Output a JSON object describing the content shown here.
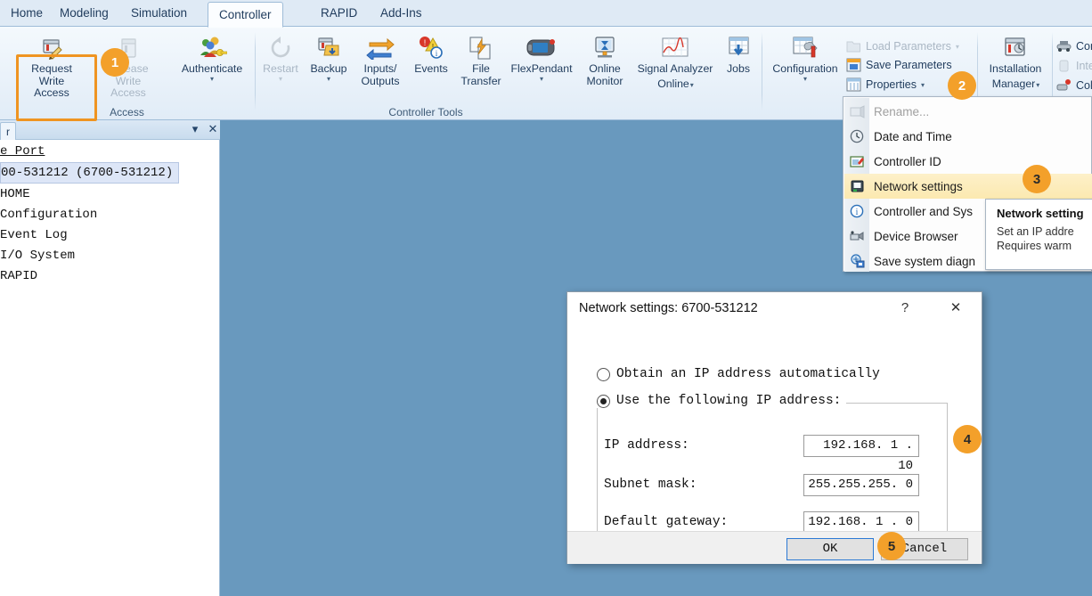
{
  "ribbon": {
    "tabs": [
      {
        "label": "Home",
        "active": false
      },
      {
        "label": "Modeling",
        "active": false
      },
      {
        "label": "Simulation",
        "active": false
      },
      {
        "label": "Controller",
        "active": true
      },
      {
        "label": "RAPID",
        "active": false
      },
      {
        "label": "Add-Ins",
        "active": false
      }
    ],
    "groups": {
      "access": {
        "label": "Access",
        "items": [
          {
            "name": "request-write-access",
            "label_line1": "Request",
            "label_line2": "Write Access",
            "disabled": false,
            "caret": false
          },
          {
            "name": "release-write-access",
            "label_line1": "Release",
            "label_line2": "Write Access",
            "disabled": true,
            "caret": false
          },
          {
            "name": "authenticate",
            "label_line1": "Authenticate",
            "label_line2": "",
            "disabled": false,
            "caret": true
          }
        ]
      },
      "controller_tools": {
        "label": "Controller Tools",
        "items": [
          {
            "name": "restart",
            "label_line1": "Restart",
            "label_line2": "",
            "disabled": true,
            "caret": true
          },
          {
            "name": "backup",
            "label_line1": "Backup",
            "label_line2": "",
            "disabled": false,
            "caret": true
          },
          {
            "name": "inputs-outputs",
            "label_line1": "Inputs/",
            "label_line2": "Outputs",
            "disabled": false,
            "caret": false
          },
          {
            "name": "events",
            "label_line1": "Events",
            "label_line2": "",
            "disabled": false,
            "caret": false
          },
          {
            "name": "file-transfer",
            "label_line1": "File",
            "label_line2": "Transfer",
            "disabled": false,
            "caret": false
          },
          {
            "name": "flexpendant",
            "label_line1": "FlexPendant",
            "label_line2": "",
            "disabled": false,
            "caret": true
          },
          {
            "name": "online-monitor",
            "label_line1": "Online",
            "label_line2": "Monitor",
            "disabled": false,
            "caret": false
          },
          {
            "name": "signal-analyzer-online",
            "label_line1": "Signal Analyzer",
            "label_line2": "Online",
            "disabled": false,
            "caret": true
          },
          {
            "name": "jobs",
            "label_line1": "Jobs",
            "label_line2": "",
            "disabled": false,
            "caret": false
          }
        ]
      },
      "configuration": {
        "items": [
          {
            "name": "configuration",
            "label_line1": "Configuration",
            "label_line2": "",
            "disabled": false,
            "caret": true
          }
        ],
        "commands": [
          {
            "name": "load-parameters",
            "label": "Load Parameters",
            "disabled": true,
            "caret": true
          },
          {
            "name": "save-parameters",
            "label": "Save Parameters",
            "disabled": false,
            "caret": false
          },
          {
            "name": "properties",
            "label": "Properties",
            "disabled": false,
            "caret": true
          }
        ]
      },
      "installation": {
        "items": [
          {
            "name": "installation-manager",
            "label_line1": "Installation",
            "label_line2": "Manager",
            "disabled": false,
            "caret": true
          }
        ]
      },
      "rightmost": {
        "commands": [
          {
            "name": "conveyor-tracking",
            "label": "Con",
            "disabled": false
          },
          {
            "name": "integrated-vision",
            "label": "Inte",
            "disabled": true
          },
          {
            "name": "collision-detection",
            "label": "Col",
            "disabled": false
          }
        ]
      }
    }
  },
  "badges": [
    {
      "number": "1",
      "style": "light"
    },
    {
      "number": "2",
      "style": "light"
    },
    {
      "number": "3",
      "style": "dark"
    },
    {
      "number": "4",
      "style": "dark"
    },
    {
      "number": "5",
      "style": "dark"
    }
  ],
  "left_panel": {
    "tab_label": "r",
    "icons": {
      "autohide": "pin-icon",
      "close": "close-icon"
    },
    "tree": [
      {
        "label": "e Port",
        "style": "link"
      },
      {
        "label": "00-531212 (6700-531212)",
        "style": "selected"
      },
      {
        "label": "HOME",
        "style": "normal"
      },
      {
        "label": "Configuration",
        "style": "normal"
      },
      {
        "label": "Event Log",
        "style": "normal"
      },
      {
        "label": "I/O System",
        "style": "normal"
      },
      {
        "label": "RAPID",
        "style": "normal"
      }
    ]
  },
  "menu": {
    "items": [
      {
        "name": "rename",
        "label": "Rename...",
        "icon": "rename-icon",
        "disabled": true,
        "highlighted": false
      },
      {
        "name": "date-and-time",
        "label": "Date and Time",
        "icon": "clock-icon",
        "disabled": false,
        "highlighted": false
      },
      {
        "name": "controller-id",
        "label": "Controller ID",
        "icon": "id-card-icon",
        "disabled": false,
        "highlighted": false
      },
      {
        "name": "network-settings",
        "label": "Network settings",
        "icon": "network-icon",
        "disabled": false,
        "highlighted": true
      },
      {
        "name": "controller-and-system",
        "label": "Controller and Sys",
        "icon": "info-icon",
        "disabled": false,
        "highlighted": false
      },
      {
        "name": "device-browser",
        "label": "Device Browser",
        "icon": "device-icon",
        "disabled": false,
        "highlighted": false
      },
      {
        "name": "save-system-diagnostics",
        "label": "Save system diagn",
        "icon": "save-diag-icon",
        "disabled": false,
        "highlighted": false
      }
    ]
  },
  "tooltip": {
    "title": "Network setting",
    "line1": "Set an IP addre",
    "line2": "Requires warm"
  },
  "dialog": {
    "title": "Network settings: 6700-531212",
    "help_glyph": "?",
    "close_glyph": "✕",
    "radio_auto": {
      "label": "Obtain an IP address automatically",
      "selected": false
    },
    "radio_manual": {
      "label": "Use the following IP address:",
      "selected": true
    },
    "fields": [
      {
        "name": "ip-address",
        "label": "IP address:",
        "value": "192.168. 1 . 10"
      },
      {
        "name": "subnet-mask",
        "label": "Subnet mask:",
        "value": "255.255.255. 0"
      },
      {
        "name": "default-gateway",
        "label": "Default gateway:",
        "value": "192.168. 1 . 0"
      }
    ],
    "ok_label": "OK",
    "cancel_label": "Cancel"
  },
  "colors": {
    "accent_orange": "#ef9421",
    "badge_orange": "#f3a02a",
    "canvas_blue": "#6999be",
    "menu_highlight": "#fce9b0"
  }
}
